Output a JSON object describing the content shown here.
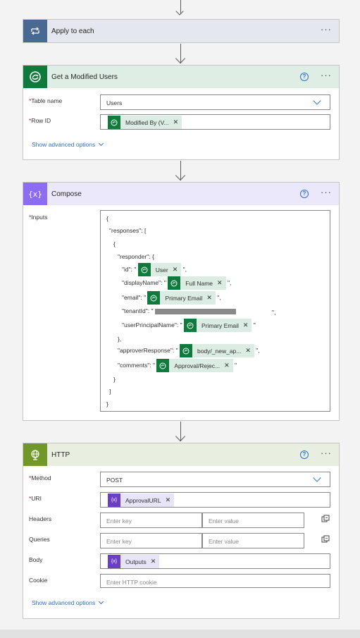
{
  "apply_to_each": {
    "title": "Apply to each"
  },
  "get_modified_users": {
    "title": "Get a Modified Users",
    "table_label": "Table name",
    "table_value": "Users",
    "row_label": "Row ID",
    "row_token": "Modified By (V...",
    "advanced": "Show advanced options"
  },
  "compose": {
    "title": "Compose",
    "inputs_label": "Inputs",
    "lines": {
      "open_brace": "{",
      "responses": "\"responses\": [",
      "open_brace2": "{",
      "responder": "\"responder\": {",
      "id_key": "\"id\": \"",
      "id_token": "User",
      "id_end": "\",",
      "display_key": "\"displayName\": \"",
      "display_token": "Full Name",
      "display_end": "\",",
      "email_key": "\"email\": \"",
      "email_token": "Primary Email",
      "email_end": "\",",
      "tenant_key": "\"tenantId\": \"",
      "tenant_end": "\",",
      "upn_key": "\"userPrincipalName\": \"",
      "upn_token": "Primary Email",
      "upn_end": "\"",
      "close_responder": "},",
      "approver_key": "\"approverResponse\": \"",
      "approver_token": "body/_new_ap...",
      "approver_end": "\",",
      "comments_key": "\"comments\": \"",
      "comments_token": "Approval/Rejec...",
      "comments_end": "\"",
      "close_obj": "}",
      "close_arr": "]",
      "close_root": "}"
    }
  },
  "http": {
    "title": "HTTP",
    "method_label": "Method",
    "method_value": "POST",
    "uri_label": "URI",
    "uri_token": "ApprovalURL",
    "headers_label": "Headers",
    "headers_key_ph": "Enter key",
    "headers_value_ph": "Enter value",
    "queries_label": "Queries",
    "queries_key_ph": "Enter key",
    "queries_value_ph": "Enter value",
    "body_label": "Body",
    "body_token": "Outputs",
    "cookie_label": "Cookie",
    "cookie_ph": "Enter HTTP cookie",
    "advanced": "Show advanced options"
  },
  "icons": {
    "loop": "loop-icon",
    "dataverse": "dataverse-icon",
    "compose": "compose-icon",
    "http": "globe-icon",
    "help": "help-icon",
    "more": "more-icon",
    "copy": "copy-icon"
  },
  "colors": {
    "loop_header": "#e4e8ee",
    "loop_icon_bg": "#486991",
    "dataverse_header": "#dfeee4",
    "dataverse_icon_bg": "#0e7a3c",
    "compose_header": "#ece8fb",
    "compose_icon_bg": "#8c6cf1",
    "http_header": "#e8eee0",
    "http_icon_bg": "#709727",
    "link": "#2b6fd6"
  }
}
